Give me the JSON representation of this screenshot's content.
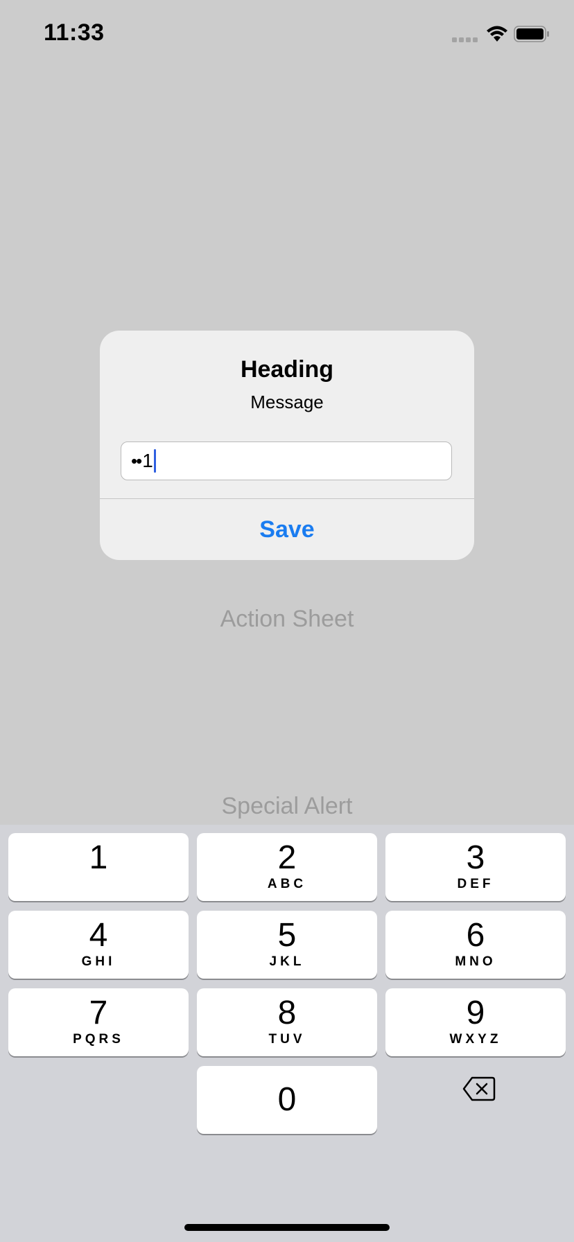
{
  "status_bar": {
    "time": "11:33",
    "icons": [
      "signal-icon",
      "wifi-icon",
      "battery-icon"
    ]
  },
  "background": {
    "action_sheet_label": "Action Sheet",
    "special_alert_label": "Special Alert"
  },
  "alert": {
    "title": "Heading",
    "message": "Message",
    "field": {
      "masked": "••",
      "last_char": "1"
    },
    "save_label": "Save"
  },
  "keypad": {
    "keys": [
      {
        "digit": "1",
        "letters": ""
      },
      {
        "digit": "2",
        "letters": "ABC"
      },
      {
        "digit": "3",
        "letters": "DEF"
      },
      {
        "digit": "4",
        "letters": "GHI"
      },
      {
        "digit": "5",
        "letters": "JKL"
      },
      {
        "digit": "6",
        "letters": "MNO"
      },
      {
        "digit": "7",
        "letters": "PQRS"
      },
      {
        "digit": "8",
        "letters": "TUV"
      },
      {
        "digit": "9",
        "letters": "WXYZ"
      },
      {
        "digit": "0",
        "letters": ""
      }
    ],
    "delete_icon": "delete-backspace-icon"
  },
  "colors": {
    "accent": "#1a7cf0",
    "caret": "#2f5fe0",
    "dim_background": "#cccccc",
    "keypad_background": "#d2d3d8"
  }
}
